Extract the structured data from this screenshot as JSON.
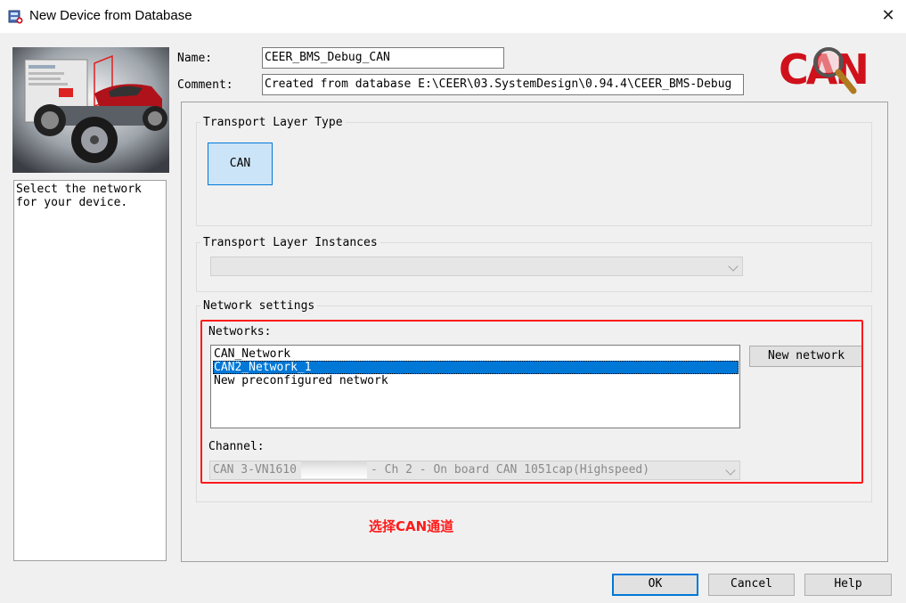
{
  "window": {
    "title": "New Device from Database",
    "close_glyph": "✕"
  },
  "description": "Select the network\nfor your device.",
  "fields": {
    "name_label": "Name:",
    "name_value": "CEER_BMS_Debug_CAN",
    "comment_label": "Comment:",
    "comment_value": "Created from database E:\\CEER\\03.SystemDesign\\0.94.4\\CEER_BMS-Debug"
  },
  "logo": {
    "text": "CAN",
    "color": "#d0111b"
  },
  "transport_type": {
    "title": "Transport Layer Type",
    "button_label": "CAN"
  },
  "transport_instances": {
    "title": "Transport Layer Instances",
    "value": ""
  },
  "network_settings": {
    "title": "Network settings",
    "networks_label": "Networks:",
    "networks": [
      "CAN_Network",
      "CAN2_Network_1",
      "New preconfigured network"
    ],
    "selected_index": 1,
    "new_network_label": "New network",
    "channel_label": "Channel:",
    "channel_value_prefix": "CAN 3-VN1610",
    "channel_value_suffix": "- Ch 2 - On board CAN 1051cap(Highspeed)"
  },
  "annotation": {
    "text": "选择CAN通道",
    "color": "#ff1a1a"
  },
  "buttons": {
    "ok": "OK",
    "cancel": "Cancel",
    "help": "Help"
  },
  "colors": {
    "selection": "#0078d7",
    "can_button_bg": "#cce4f7",
    "highlight_box": "#ff1a1a"
  }
}
